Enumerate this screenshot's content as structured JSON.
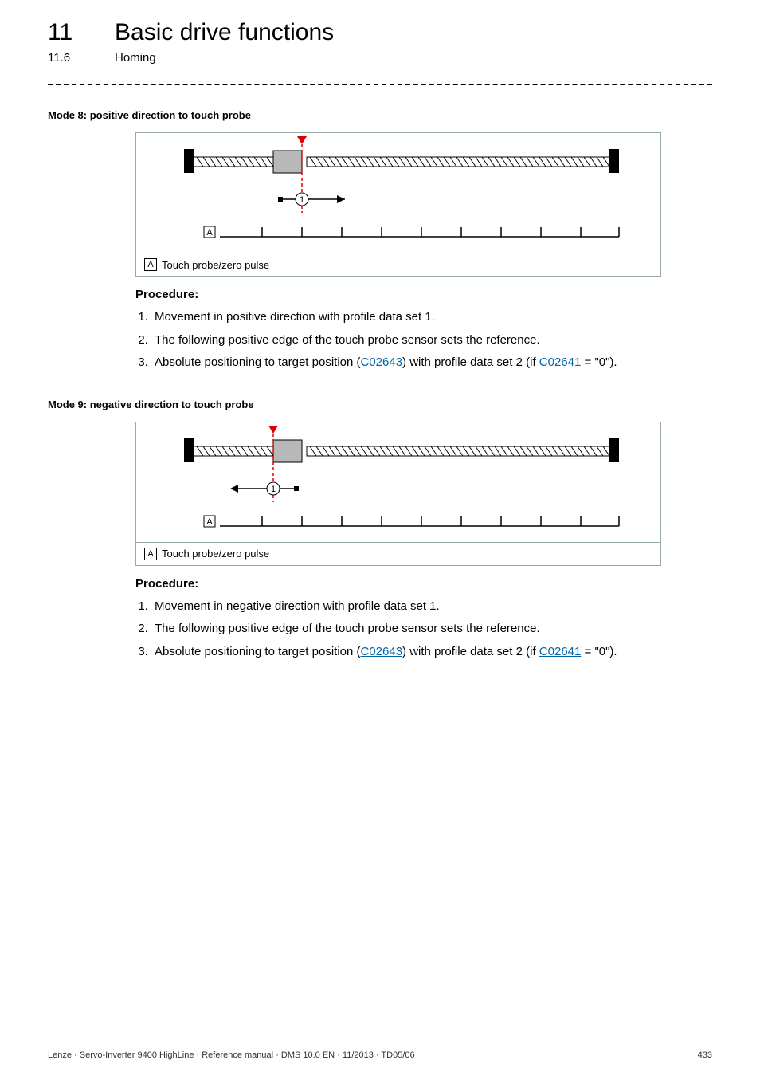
{
  "chapter": {
    "number": "11",
    "title": "Basic drive functions"
  },
  "section": {
    "number": "11.6",
    "title": "Homing"
  },
  "mode8": {
    "heading": "Mode 8: positive direction to touch probe",
    "legend": {
      "letter": "A",
      "text": "Touch probe/zero pulse"
    },
    "procedure_label": "Procedure:",
    "steps": {
      "s1": "Movement in positive direction with profile data set 1.",
      "s2": "The following positive edge of the touch probe sensor sets the reference.",
      "s3_pre": "Absolute positioning to target position (",
      "s3_link1": "C02643",
      "s3_mid": ") with profile data set 2 (if ",
      "s3_link2": "C02641",
      "s3_post": " = \"0\")."
    }
  },
  "mode9": {
    "heading": "Mode 9: negative direction to touch probe",
    "legend": {
      "letter": "A",
      "text": "Touch probe/zero pulse"
    },
    "procedure_label": "Procedure:",
    "steps": {
      "s1": "Movement in negative direction with profile data set 1.",
      "s2": "The following positive edge of the touch probe sensor sets the reference.",
      "s3_pre": "Absolute positioning to target position (",
      "s3_link1": "C02643",
      "s3_mid": ") with profile data set 2 (if ",
      "s3_link2": "C02641",
      "s3_post": " = \"0\")."
    }
  },
  "footer": {
    "left": "Lenze · Servo-Inverter 9400 HighLine · Reference manual · DMS 10.0 EN · 11/2013 · TD05/06",
    "right": "433"
  },
  "glyphs": {
    "letter_A": "A",
    "marker_1": "1"
  }
}
